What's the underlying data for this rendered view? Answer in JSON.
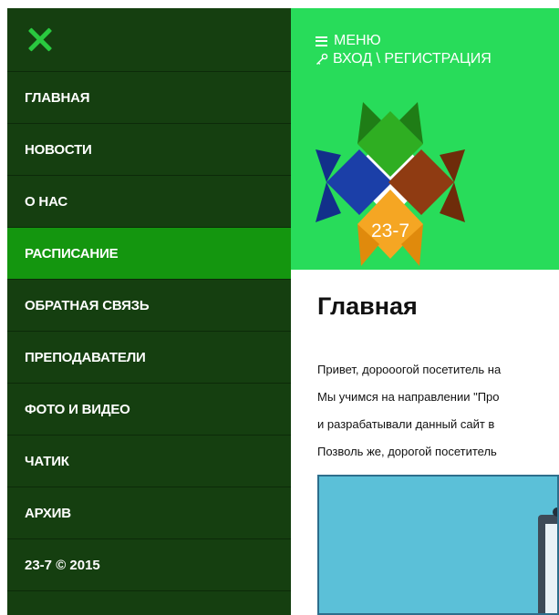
{
  "sidebar": {
    "close_icon": "close-icon",
    "accent_color": "#29c93f",
    "items": [
      {
        "label": "ГЛАВНАЯ",
        "active": false
      },
      {
        "label": "НОВОСТИ",
        "active": false
      },
      {
        "label": "О НАС",
        "active": false
      },
      {
        "label": "РАСПИСАНИЕ",
        "active": true
      },
      {
        "label": "ОБРАТНАЯ СВЯЗЬ",
        "active": false
      },
      {
        "label": "ПРЕПОДАВАТЕЛИ",
        "active": false
      },
      {
        "label": "ФОТО И ВИДЕО",
        "active": false
      },
      {
        "label": "ЧАТИК",
        "active": false
      },
      {
        "label": "АРХИВ",
        "active": false
      }
    ],
    "footer": "23-7 © 2015"
  },
  "header": {
    "menu_label": "МЕНЮ",
    "menu_icon": "hamburger-icon",
    "login_label": "ВХОД \\ РЕГИСТРАЦИЯ",
    "login_icon": "key-icon",
    "background_color": "#28dc5a",
    "logo_text": "23-7"
  },
  "main": {
    "title": "Главная",
    "paragraphs": [
      "Привет, дорооогой посетитель на",
      "Мы учимся на направлении \"Про",
      "и разрабатывали данный сайт в",
      "Позволь же, дорогой посетитель"
    ]
  },
  "colors": {
    "sidebar_bg": "#153f10",
    "active_item_bg": "#14960f",
    "logo_green": "#2fae22",
    "logo_blue": "#1b3fa8",
    "logo_brown": "#8f3b12",
    "logo_orange": "#f5a623"
  }
}
